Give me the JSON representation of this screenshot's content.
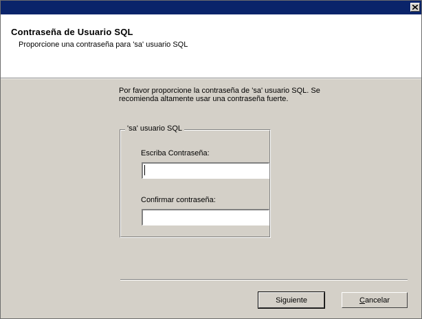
{
  "dialog": {
    "close_icon": "close-icon"
  },
  "header": {
    "title": "Contraseña de Usuario SQL",
    "subtitle": "Proporcione una contraseña para 'sa' usuario SQL"
  },
  "body": {
    "instructions": "Por favor proporcione la contraseña de 'sa' usuario SQL. Se recomienda altamente usar una contraseña fuerte.",
    "group_label": "'sa' usuario SQL",
    "password_label": "Escriba Contraseña:",
    "password_value": "",
    "confirm_label": "Confirmar contraseña:",
    "confirm_value": ""
  },
  "buttons": {
    "next_label": "Siguiente",
    "cancel_label_first": "C",
    "cancel_label_rest": "ancelar"
  },
  "colors": {
    "titlebar": "#0a246a",
    "dialog_face": "#d4d0c8",
    "header_bg": "#ffffff"
  }
}
